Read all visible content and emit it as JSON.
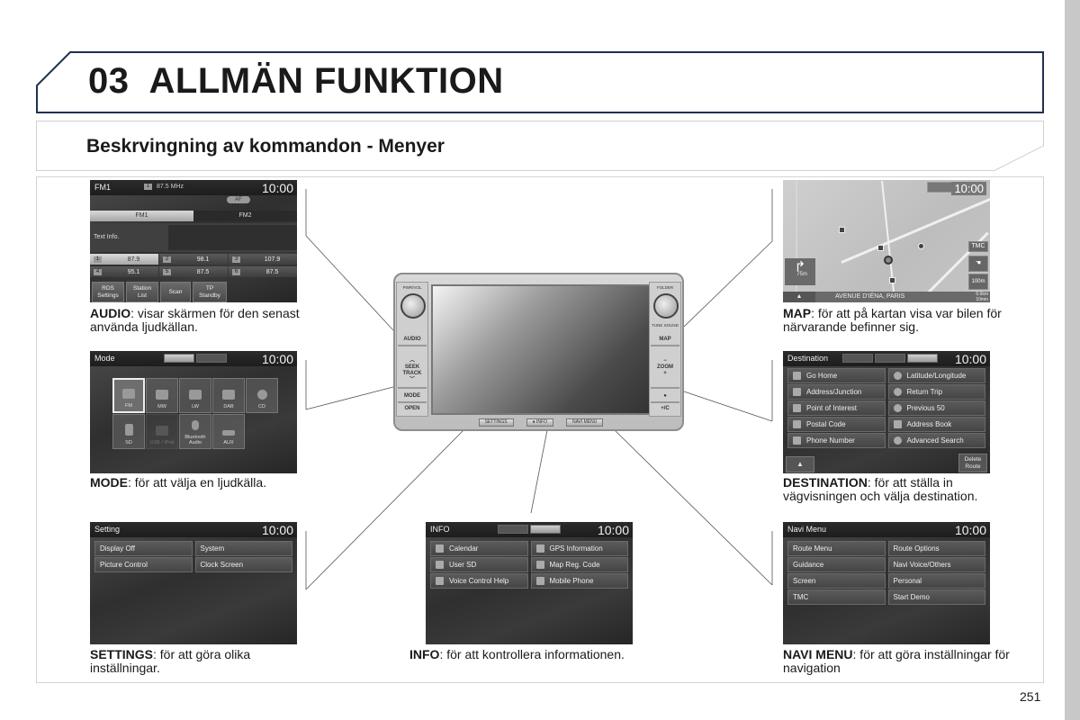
{
  "chapter": {
    "number": "03",
    "title": "ALLMÄN FUNKTION"
  },
  "section": {
    "title": "Beskrvingning av kommandon - Menyer"
  },
  "page_number": "251",
  "head_unit": {
    "knob_left_label": "PWR/VOL",
    "knob_right_label": "FOLDER",
    "knob_right_sub": "TUNE SOUND",
    "left_buttons": [
      "AUDIO",
      "SEEK TRACK",
      "MODE",
      "OPEN"
    ],
    "right_buttons": [
      "MAP",
      "ZOOM",
      "+/C"
    ],
    "bottom_buttons": [
      "SETTINGS",
      "● INFO",
      "NAVI MENU"
    ]
  },
  "screens": {
    "audio": {
      "title": "FM1",
      "clock": "10:00",
      "preset_number": "1",
      "frequency": "87.5 MHz",
      "af_label": "AF",
      "bands": [
        "FM1",
        "FM2"
      ],
      "text_info_label": "Text Info.",
      "presets": [
        {
          "num": "1",
          "value": "87.9"
        },
        {
          "num": "2",
          "value": "98.1"
        },
        {
          "num": "3",
          "value": "107.9"
        },
        {
          "num": "4",
          "value": "95.1"
        },
        {
          "num": "5",
          "value": "87.5"
        },
        {
          "num": "6",
          "value": "87.5"
        }
      ],
      "softkeys": [
        "RDS Settings",
        "Station List",
        "Scan",
        "TP Standby"
      ]
    },
    "mode": {
      "title": "Mode",
      "clock": "10:00",
      "items": [
        "FM",
        "MW",
        "LW",
        "DAB",
        "CD",
        "SD",
        "USB / iPod",
        "Bluetooth Audio",
        "AUX"
      ]
    },
    "settings": {
      "title": "Setting",
      "clock": "10:00",
      "items": [
        "Display Off",
        "System",
        "Picture Control",
        "Clock Screen"
      ]
    },
    "info": {
      "title": "INFO",
      "clock": "10:00",
      "items": [
        "Calendar",
        "GPS Information",
        "User SD",
        "Map Reg. Code",
        "Voice Control Help",
        "Mobile Phone"
      ]
    },
    "navi": {
      "title": "Navi Menu",
      "clock": "10:00",
      "items": [
        "Route Menu",
        "Route Options",
        "Guidance",
        "Navi Voice/Others",
        "Screen",
        "Personal",
        "TMC",
        "Start Demo"
      ]
    },
    "destination": {
      "title": "Destination",
      "clock": "10:00",
      "items": [
        "Go Home",
        "Latitude/Longitude",
        "Address/Junction",
        "Return Trip",
        "Point of Interest",
        "Previous 50",
        "Postal Code",
        "Address Book",
        "Phone Number",
        "Advanced Search"
      ],
      "up_button": "▲",
      "delete_route": "Delete Route"
    },
    "map": {
      "clock": "10:00",
      "street": "AVENUE D'IÉNA, PARIS",
      "turn_distance": "75m",
      "tmc_label": "TMC",
      "scale": "100m",
      "distance_remaining": "6.6km",
      "time_remaining": "10min",
      "up_button": "▲"
    }
  },
  "captions": {
    "audio": {
      "key": "AUDIO",
      "text": ": visar skärmen för den senast använda ljudkällan."
    },
    "mode": {
      "key": "MODE",
      "text": ": för att välja en ljudkälla."
    },
    "settings": {
      "key": "SETTINGS",
      "text": ": för att göra olika inställningar."
    },
    "info": {
      "key": "INFO",
      "text": ": för att kontrollera informationen."
    },
    "map": {
      "key": "MAP",
      "text": ": för att på kartan visa var bilen för närvarande befinner sig."
    },
    "destination": {
      "key": "DESTINATION",
      "text": ": för att ställa in vägvisningen och välja destination."
    },
    "navi": {
      "key": "NAVI MENU",
      "text": ": för att göra inställningar för navigation"
    }
  }
}
